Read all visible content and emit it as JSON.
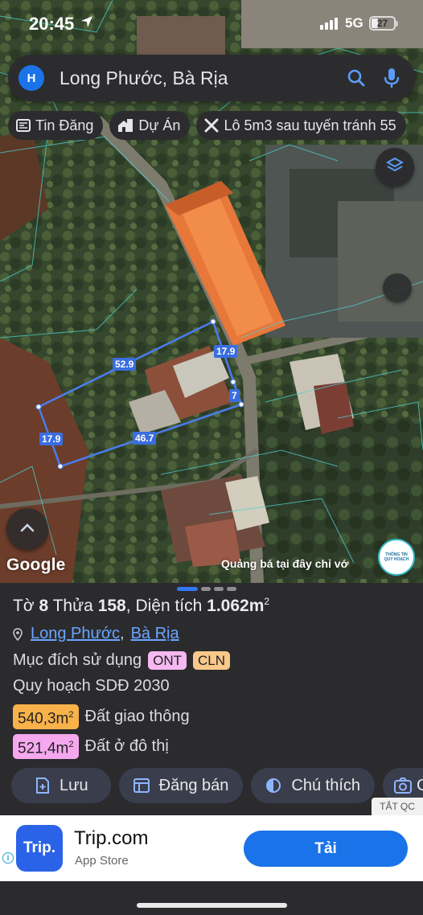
{
  "status_bar": {
    "time": "20:45",
    "network": "5G",
    "battery": "27"
  },
  "search": {
    "avatar_letter": "H",
    "query": "Long Phước, Bà Rịa"
  },
  "chips": [
    {
      "icon": "newspaper-icon",
      "label": "Tin Đăng"
    },
    {
      "icon": "building-icon",
      "label": "Dự Án"
    },
    {
      "icon": "tools-icon",
      "label": "Lô 5m3 sau tuyến tránh 55"
    }
  ],
  "map": {
    "measurements": [
      "52.9",
      "17.9",
      "7",
      "17.9",
      "46.7"
    ],
    "google_logo": "Google",
    "promo_text": "Quảng bá tại đây chỉ vớ",
    "badge_line1": "THÔNG TIN",
    "badge_line2": "QUY HOẠCH",
    "parcel_color": "#4a7cf0"
  },
  "parcel": {
    "to_label": "Tờ",
    "to": "8",
    "thua_label": "Thửa",
    "thua": "158",
    "area_label": "Diện tích",
    "area": "1.062m",
    "area_sup": "2",
    "ward": "Long Phước",
    "city": "Bà Rịa",
    "purpose_label": "Mục đích sử dụng",
    "purpose_tags": [
      "ONT",
      "CLN"
    ],
    "plan_label": "Quy hoạch SDĐ 2030",
    "plan_areas": [
      {
        "value": "540,3m",
        "sup": "2",
        "label": "Đất giao thông",
        "color": "#f8b24a"
      },
      {
        "value": "521,4m",
        "sup": "2",
        "label": "Đất ở đô thị",
        "color": "#f5a8ee"
      }
    ]
  },
  "actions": [
    {
      "icon": "save-plus-icon",
      "label": "Lưu"
    },
    {
      "icon": "listing-icon",
      "label": "Đăng bán"
    },
    {
      "icon": "contrast-icon",
      "label": "Chú thích"
    },
    {
      "icon": "camera-icon",
      "label": "C"
    }
  ],
  "ad": {
    "close_label": "TẮT QC",
    "logo_text": "Trip.",
    "app_name": "Trip.com",
    "store": "App Store",
    "cta": "Tải"
  }
}
